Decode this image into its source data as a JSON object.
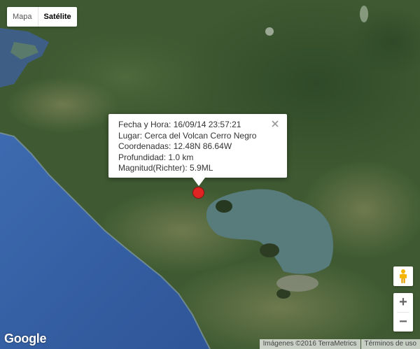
{
  "map_type": {
    "map_label": "Mapa",
    "satellite_label": "Satélite",
    "selected": "Satélite"
  },
  "info_window": {
    "lines": [
      "Fecha y Hora: 16/09/14 23:57:21",
      "Lugar: Cerca del Volcan Cerro Negro",
      "Coordenadas: 12.48N 86.64W",
      "Profundidad: 1.0 km",
      "Magnitud(Richter): 5.9ML"
    ],
    "close_symbol": "×"
  },
  "controls": {
    "zoom_in": "+",
    "zoom_out": "−",
    "pegman_icon": "pegman-icon"
  },
  "footer": {
    "logo": "Google",
    "imagery": "Imágenes ©2016 TerraMetrics",
    "terms": "Términos de uso"
  },
  "colors": {
    "marker": "#e02424",
    "ocean": "#3c63a8",
    "lake": "#587b7c",
    "land": "#3f5a32"
  }
}
